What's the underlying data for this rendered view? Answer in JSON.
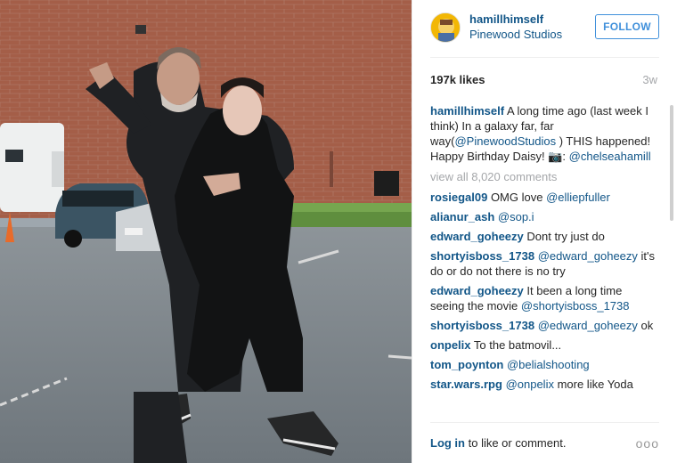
{
  "post": {
    "username": "hamillhimself",
    "location": "Pinewood Studios",
    "follow_label": "FOLLOW",
    "likes": "197k likes",
    "age": "3w",
    "caption": {
      "username": "hamillhimself",
      "text_1": " A long time ago (last week I think) In a galaxy far, far way(",
      "mention_1": "@PinewoodStudios",
      "text_2": " ) THIS happened! Happy Birthday Daisy! 📷: ",
      "mention_2": "@chelseahamill"
    },
    "view_all": "view all 8,020 comments",
    "comments": [
      {
        "user": "rosiegal09",
        "text": " OMG love ",
        "mention": "@elliepfuller",
        "after": ""
      },
      {
        "user": "alianur_ash",
        "text": " ",
        "mention": "@sop.i",
        "after": ""
      },
      {
        "user": "edward_goheezy",
        "text": " Dont try just do",
        "mention": "",
        "after": ""
      },
      {
        "user": "shortyisboss_1738",
        "text": " ",
        "mention": "@edward_goheezy",
        "after": " it's do or do not there is no try"
      },
      {
        "user": "edward_goheezy",
        "text": " It been a long time seeing the movie ",
        "mention": "@shortyisboss_1738",
        "after": ""
      },
      {
        "user": "shortyisboss_1738",
        "text": " ",
        "mention": "@edward_goheezy",
        "after": " ok"
      },
      {
        "user": "onpelix",
        "text": " To the batmovil...",
        "mention": "",
        "after": ""
      },
      {
        "user": "tom_poynton",
        "text": " ",
        "mention": "@belialshooting",
        "after": ""
      },
      {
        "user": "star.wars.rpg",
        "text": " ",
        "mention": "@onpelix",
        "after": " more like Yoda"
      }
    ],
    "footer": {
      "login": "Log in",
      "rest": " to like or comment.",
      "more": "ooo"
    }
  },
  "colors": {
    "link": "#125688",
    "follow": "#4090db",
    "muted": "#a5a7aa"
  }
}
